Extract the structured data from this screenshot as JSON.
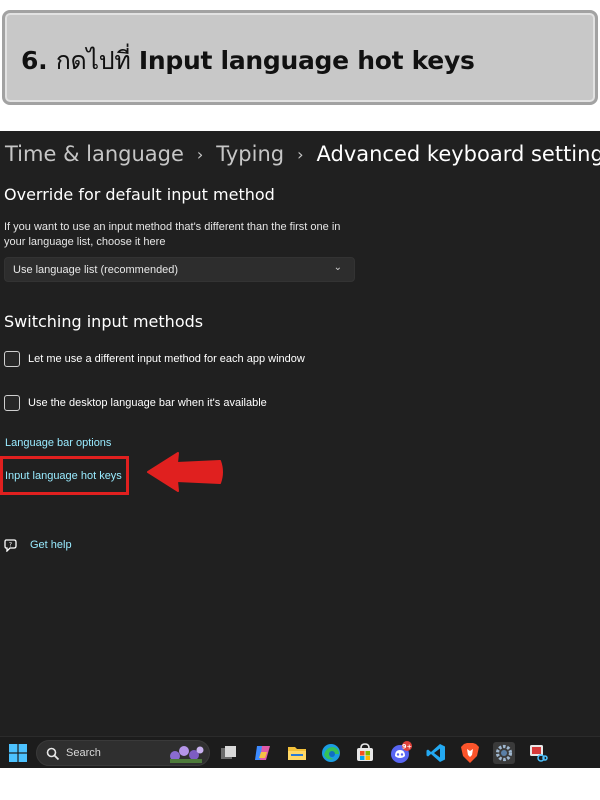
{
  "banner": {
    "step": "6.",
    "thai_text": "กดไปที่",
    "highlight": "Input language hot keys"
  },
  "settings": {
    "breadcrumb": {
      "root": "Time & language",
      "middle": "Typing",
      "current": "Advanced keyboard settings",
      "separator": "›"
    },
    "override": {
      "title": "Override for default input method",
      "description": "If you want to use an input method that's different than the first one in your language list, choose it here",
      "dropdown_value": "Use language list (recommended)"
    },
    "switching": {
      "title": "Switching input methods",
      "options": [
        {
          "label": "Let me use a different input method for each app window",
          "checked": false
        },
        {
          "label": "Use the desktop language bar when it's available",
          "checked": false
        }
      ]
    },
    "links": {
      "language_bar_options": "Language bar options",
      "input_language_hot_keys": "Input language hot keys"
    },
    "help": {
      "label": "Get help"
    }
  },
  "taskbar": {
    "search_label": "Search",
    "discord_badge": "9+",
    "icons": [
      "windows-start-icon",
      "search-icon",
      "task-view-icon",
      "copilot-icon",
      "file-explorer-icon",
      "edge-icon",
      "store-icon",
      "discord-icon",
      "vscode-icon",
      "brave-icon",
      "settings-icon",
      "snipping-tool-icon"
    ]
  },
  "colors": {
    "window_bg": "#202020",
    "link": "#99ebff",
    "highlight_red": "#e0201f",
    "banner_bg": "#c8c8c8"
  }
}
